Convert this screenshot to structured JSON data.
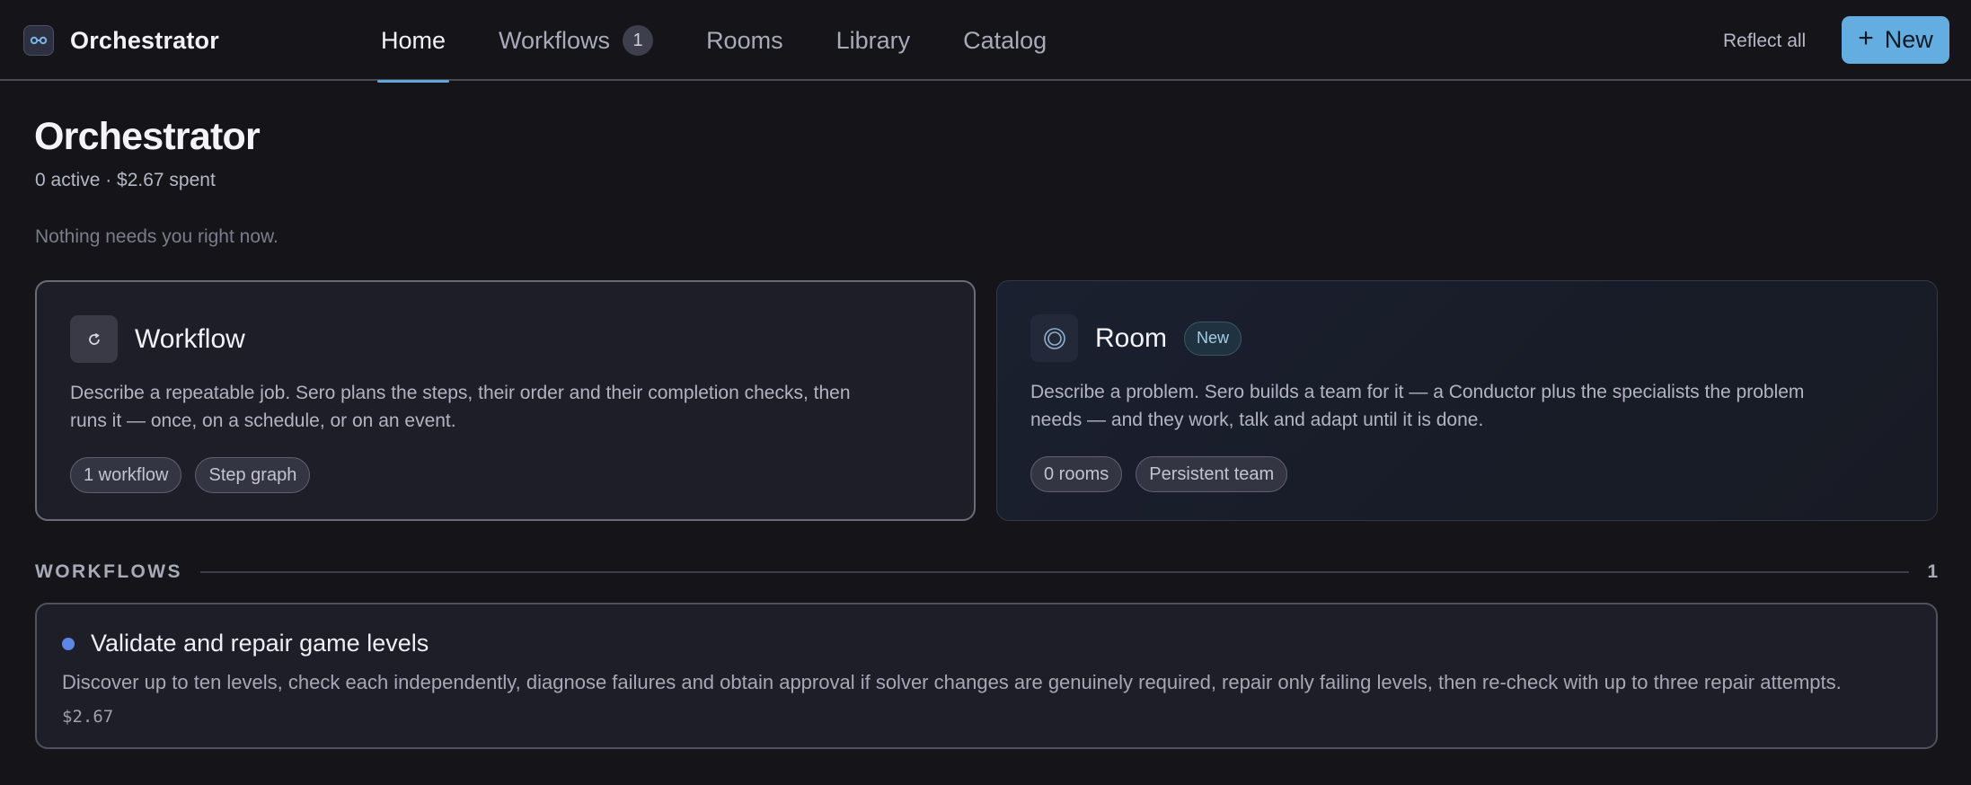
{
  "app": {
    "name": "Orchestrator",
    "logo_icon": "orchestrator-logo-icon"
  },
  "nav": {
    "tabs": [
      {
        "label": "Home",
        "active": true
      },
      {
        "label": "Workflows",
        "badge": "1"
      },
      {
        "label": "Rooms"
      },
      {
        "label": "Library"
      },
      {
        "label": "Catalog"
      }
    ]
  },
  "toolbar": {
    "reflect_label": "Reflect all",
    "new_label": "New",
    "new_icon": "plus-icon"
  },
  "header": {
    "title": "Orchestrator",
    "stats": "0 active · $2.67 spent",
    "empty_message": "Nothing needs you right now."
  },
  "cards": {
    "workflow": {
      "icon": "refresh-icon",
      "title": "Workflow",
      "description": "Describe a repeatable job. Sero plans the steps, their order and their completion checks, then runs it — once, on a schedule, or on an event.",
      "tags": [
        "1 workflow",
        "Step graph"
      ]
    },
    "room": {
      "icon": "target-ring-icon",
      "title": "Room",
      "badge": "New",
      "description": "Describe a problem. Sero builds a team for it — a Conductor plus the specialists the problem needs — and they work, talk and adapt until it is done.",
      "tags": [
        "0 rooms",
        "Persistent team"
      ]
    }
  },
  "workflows_section": {
    "title": "WORKFLOWS",
    "count": "1",
    "items": [
      {
        "title": "Validate and repair game levels",
        "description": "Discover up to ten levels, check each independently, diagnose failures and obtain approval if solver changes are genuinely required, repair only failing levels, then re-check with up to three repair attempts.",
        "cost": "$2.67",
        "status_color": "#5e86e6"
      }
    ]
  },
  "colors": {
    "accent": "#63ade0",
    "background": "#141419",
    "card": "#1d1e27"
  }
}
